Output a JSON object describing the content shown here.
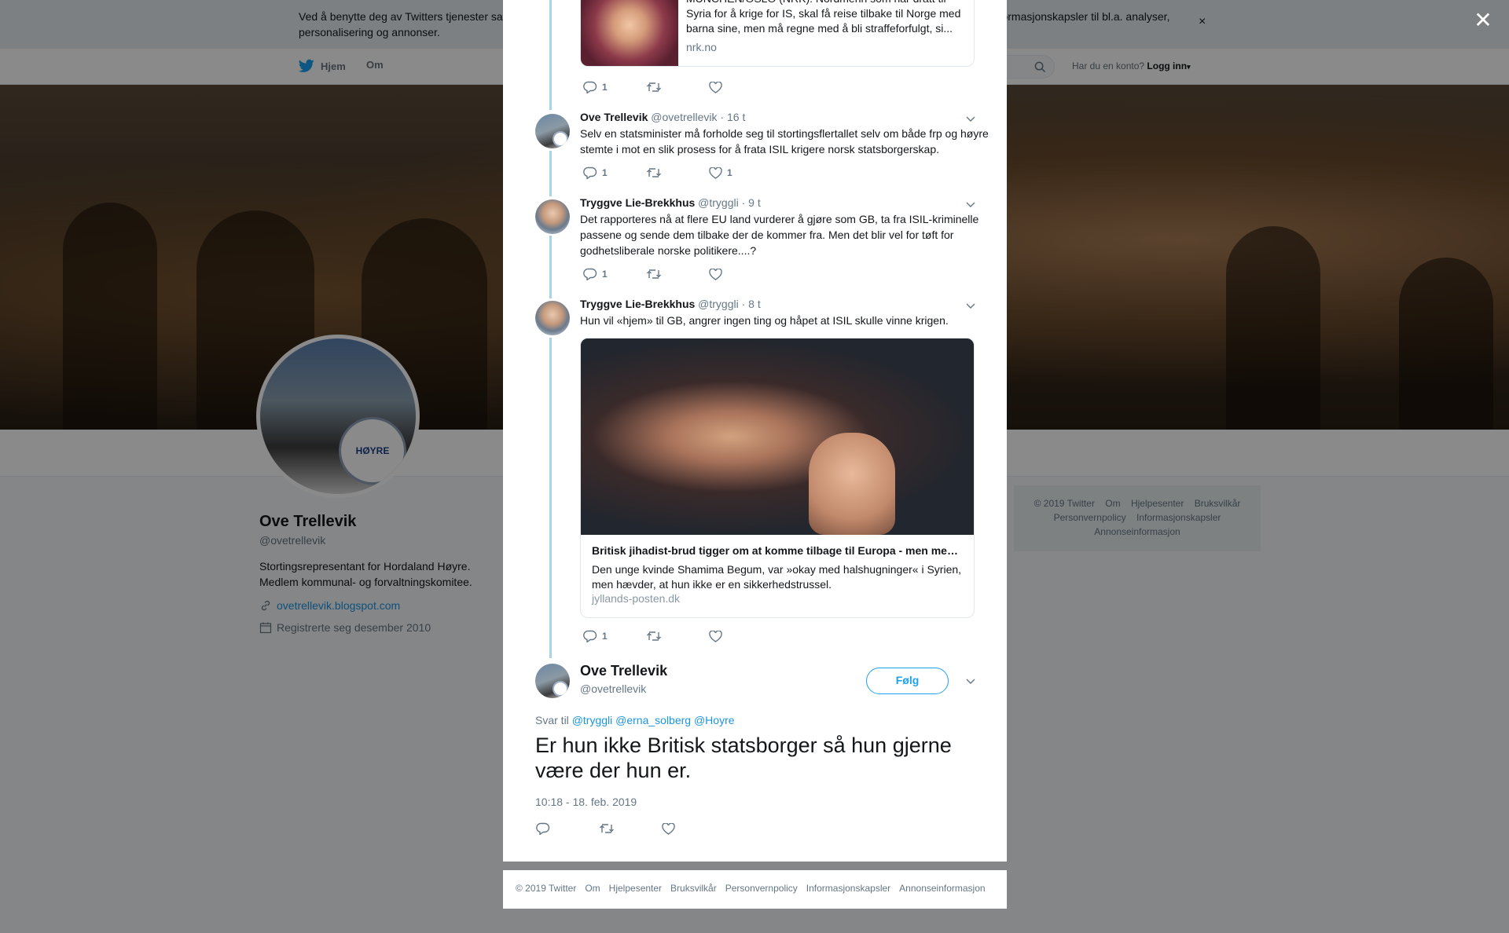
{
  "cookie_bar": {
    "text_start": "Ved å benytte deg av Twitters tjenester sa",
    "text_end": "informasjonskapsler til bl.a. analyser,",
    "text_line2": "personalisering og annonser.",
    "close_label": "×"
  },
  "topnav": {
    "home_label": "Hjem",
    "about_label": "Om",
    "login_prompt": "Har du en konto?",
    "login_label": "Logg inn"
  },
  "profile": {
    "name": "Ove Trellevik",
    "handle": "@ovetrellevik",
    "bio": "Stortingsrepresentant for Hordaland Høyre. Medlem kommunal- og forvaltningskomitee.",
    "link": "ovetrellevik.blogspot.com",
    "joined": "Registrerte seg desember 2010",
    "badge_text": "HØYRE"
  },
  "side_footer": {
    "items": [
      "© 2019 Twitter",
      "Om",
      "Hjelpesenter",
      "Bruksvilkår",
      "Personvernpolicy",
      "Informasjonskapsler",
      "Annonseinformasjon"
    ]
  },
  "overlay": {
    "close_label": "✕"
  },
  "thread": {
    "tweet0": {
      "card_text": "MÜNCHEN/OSLO (NRK): Nordmenn som har dratt til Syria for å krige for IS, skal få reise tilbake til Norge med barna sine, men må regne med å bli straffeforfulgt, si...",
      "card_domain": "nrk.no",
      "reply_count": "1",
      "retweet_count": "",
      "like_count": ""
    },
    "tweet1": {
      "name": "Ove Trellevik",
      "handle": "@ovetrellevik",
      "time": "· 16 t",
      "text": "Selv en statsminister må forholde seg til stortingsflertallet selv om  både frp og høyre stemte i mot en slik prosess for å frata ISIL krigere norsk statsborgerskap.",
      "reply_count": "1",
      "retweet_count": "",
      "like_count": "1"
    },
    "tweet2": {
      "name": "Tryggve Lie-Brekkhus",
      "handle": "@tryggli",
      "time": "· 9 t",
      "text": "Det rapporteres nå at flere EU land vurderer å gjøre som GB, ta fra ISIL-kriminelle passene og sende dem tilbake der de kommer fra. Men det blir vel for tøft for godhetsliberale norske politikere....?",
      "reply_count": "1",
      "retweet_count": "",
      "like_count": ""
    },
    "tweet3": {
      "name": "Tryggve Lie-Brekkhus",
      "handle": "@tryggli",
      "time": "· 8 t",
      "text": "Hun vil «hjem» til GB, angrer ingen ting og håpet at ISIL skulle vinne krigen.",
      "card_title": "Britisk jihadist-brud tigger om at komme tilbage til Europa - men mener...",
      "card_desc": "Den unge kvinde Shamima Begum, var »okay med halshugninger« i Syrien, men hævder, at hun ikke er en sikkerhedstrussel.",
      "card_domain": "jyllands-posten.dk",
      "reply_count": "1",
      "retweet_count": "",
      "like_count": ""
    }
  },
  "main_tweet": {
    "name": "Ove Trellevik",
    "handle": "@ovetrellevik",
    "follow_label": "Følg",
    "reply_prefix": "Svar til",
    "mentions": [
      "@tryggli",
      "@erna_solberg",
      "@Hoyre"
    ],
    "text": "Er hun ikke Britisk statsborger så hun gjerne være der hun er.",
    "timestamp": "10:18 - 18. feb. 2019"
  },
  "modal_footer": {
    "items": [
      "© 2019 Twitter",
      "Om",
      "Hjelpesenter",
      "Bruksvilkår",
      "Personvernpolicy",
      "Informasjonskapsler",
      "Annonseinformasjon"
    ]
  },
  "colors": {
    "twitter_blue": "#1da1f2",
    "link_blue": "#1b95e0",
    "thread_line": "#a6d3f2",
    "text_gray": "#657786"
  },
  "icons": [
    "twitter-bird-icon",
    "search-icon",
    "reply-icon",
    "retweet-icon",
    "like-icon",
    "chevron-down-icon",
    "link-icon",
    "calendar-icon",
    "close-icon"
  ]
}
